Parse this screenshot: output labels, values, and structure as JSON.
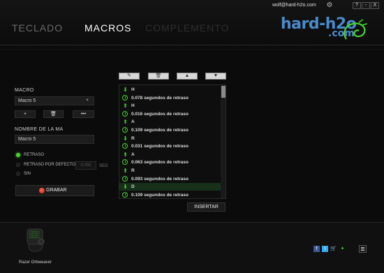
{
  "window": {
    "user_email": "wolf@hard-h2o.com",
    "help_label": "?",
    "minimize_label": "-",
    "close_label": "X"
  },
  "tabs": [
    "TECLADO",
    "MACROS",
    "COMPLEMENTO"
  ],
  "logo": {
    "text": "hard-h2o",
    "sub": ".com"
  },
  "left_panel": {
    "macro_label": "MACRO",
    "macro_selected": "Macro 5",
    "btn_add": "+",
    "btn_delete": "🗑",
    "btn_more": "•••",
    "name_label": "NOMBRE DE LA MA",
    "name_value": "Macro 5",
    "radios": [
      {
        "label": "RETRASO",
        "checked": true
      },
      {
        "label": "RETRASO POR DEFECTO",
        "checked": false
      },
      {
        "label": "SIN",
        "checked": false
      }
    ],
    "delay_value": "0.050",
    "delay_unit": "SEG",
    "record_label": "GRABAR"
  },
  "toolbar": {
    "edit": "✎",
    "delete": "🗑",
    "up": "▲",
    "down": "▼"
  },
  "macro_list": [
    {
      "kind": "down",
      "text": "H"
    },
    {
      "kind": "delay",
      "text": "0.078 segundos de retraso"
    },
    {
      "kind": "up",
      "text": "H"
    },
    {
      "kind": "delay",
      "text": "0.016 segundos de retraso"
    },
    {
      "kind": "up",
      "text": "A"
    },
    {
      "kind": "delay",
      "text": "0.109 segundos de retraso"
    },
    {
      "kind": "down",
      "text": "R"
    },
    {
      "kind": "delay",
      "text": "0.031 segundos de retraso"
    },
    {
      "kind": "up",
      "text": "A"
    },
    {
      "kind": "delay",
      "text": "0.063 segundos de retraso"
    },
    {
      "kind": "up",
      "text": "R"
    },
    {
      "kind": "delay",
      "text": "0.093 segundos de retraso"
    },
    {
      "kind": "down",
      "text": "D",
      "selected": true
    },
    {
      "kind": "delay",
      "text": "0.109 segundos de retraso"
    }
  ],
  "insert_label": "INSERTAR",
  "device": {
    "name": "Razer Orbweaver"
  },
  "social": {
    "fb": "f",
    "tw": "t",
    "cart": "🛒",
    "razer": "✦"
  },
  "colors": {
    "accent": "#44d62c",
    "record": "#d8261a",
    "logo": "#4a8ac9"
  }
}
